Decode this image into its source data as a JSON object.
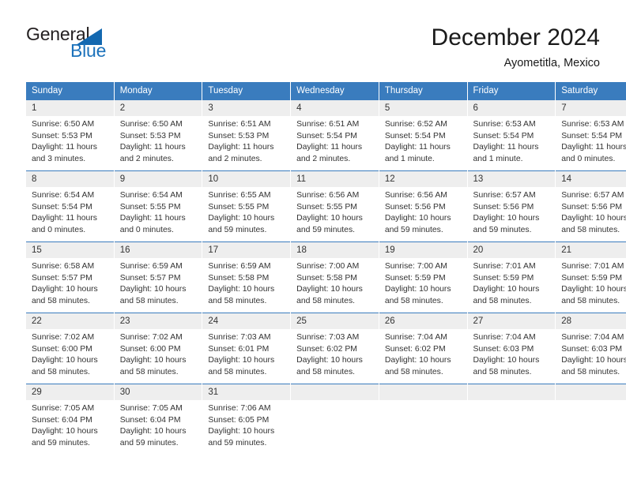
{
  "logo": {
    "word_top": "General",
    "word_bottom": "Blue",
    "accent_color": "#1368b0"
  },
  "header": {
    "title": "December 2024",
    "subtitle": "Ayometitla, Mexico"
  },
  "calendar": {
    "header_bg": "#3a7cbe",
    "daynum_bg": "#eeeeee",
    "weekdays": [
      "Sunday",
      "Monday",
      "Tuesday",
      "Wednesday",
      "Thursday",
      "Friday",
      "Saturday"
    ],
    "weeks": [
      [
        {
          "day": "1",
          "sunrise": "Sunrise: 6:50 AM",
          "sunset": "Sunset: 5:53 PM",
          "daylight": "Daylight: 11 hours and 3 minutes."
        },
        {
          "day": "2",
          "sunrise": "Sunrise: 6:50 AM",
          "sunset": "Sunset: 5:53 PM",
          "daylight": "Daylight: 11 hours and 2 minutes."
        },
        {
          "day": "3",
          "sunrise": "Sunrise: 6:51 AM",
          "sunset": "Sunset: 5:53 PM",
          "daylight": "Daylight: 11 hours and 2 minutes."
        },
        {
          "day": "4",
          "sunrise": "Sunrise: 6:51 AM",
          "sunset": "Sunset: 5:54 PM",
          "daylight": "Daylight: 11 hours and 2 minutes."
        },
        {
          "day": "5",
          "sunrise": "Sunrise: 6:52 AM",
          "sunset": "Sunset: 5:54 PM",
          "daylight": "Daylight: 11 hours and 1 minute."
        },
        {
          "day": "6",
          "sunrise": "Sunrise: 6:53 AM",
          "sunset": "Sunset: 5:54 PM",
          "daylight": "Daylight: 11 hours and 1 minute."
        },
        {
          "day": "7",
          "sunrise": "Sunrise: 6:53 AM",
          "sunset": "Sunset: 5:54 PM",
          "daylight": "Daylight: 11 hours and 0 minutes."
        }
      ],
      [
        {
          "day": "8",
          "sunrise": "Sunrise: 6:54 AM",
          "sunset": "Sunset: 5:54 PM",
          "daylight": "Daylight: 11 hours and 0 minutes."
        },
        {
          "day": "9",
          "sunrise": "Sunrise: 6:54 AM",
          "sunset": "Sunset: 5:55 PM",
          "daylight": "Daylight: 11 hours and 0 minutes."
        },
        {
          "day": "10",
          "sunrise": "Sunrise: 6:55 AM",
          "sunset": "Sunset: 5:55 PM",
          "daylight": "Daylight: 10 hours and 59 minutes."
        },
        {
          "day": "11",
          "sunrise": "Sunrise: 6:56 AM",
          "sunset": "Sunset: 5:55 PM",
          "daylight": "Daylight: 10 hours and 59 minutes."
        },
        {
          "day": "12",
          "sunrise": "Sunrise: 6:56 AM",
          "sunset": "Sunset: 5:56 PM",
          "daylight": "Daylight: 10 hours and 59 minutes."
        },
        {
          "day": "13",
          "sunrise": "Sunrise: 6:57 AM",
          "sunset": "Sunset: 5:56 PM",
          "daylight": "Daylight: 10 hours and 59 minutes."
        },
        {
          "day": "14",
          "sunrise": "Sunrise: 6:57 AM",
          "sunset": "Sunset: 5:56 PM",
          "daylight": "Daylight: 10 hours and 58 minutes."
        }
      ],
      [
        {
          "day": "15",
          "sunrise": "Sunrise: 6:58 AM",
          "sunset": "Sunset: 5:57 PM",
          "daylight": "Daylight: 10 hours and 58 minutes."
        },
        {
          "day": "16",
          "sunrise": "Sunrise: 6:59 AM",
          "sunset": "Sunset: 5:57 PM",
          "daylight": "Daylight: 10 hours and 58 minutes."
        },
        {
          "day": "17",
          "sunrise": "Sunrise: 6:59 AM",
          "sunset": "Sunset: 5:58 PM",
          "daylight": "Daylight: 10 hours and 58 minutes."
        },
        {
          "day": "18",
          "sunrise": "Sunrise: 7:00 AM",
          "sunset": "Sunset: 5:58 PM",
          "daylight": "Daylight: 10 hours and 58 minutes."
        },
        {
          "day": "19",
          "sunrise": "Sunrise: 7:00 AM",
          "sunset": "Sunset: 5:59 PM",
          "daylight": "Daylight: 10 hours and 58 minutes."
        },
        {
          "day": "20",
          "sunrise": "Sunrise: 7:01 AM",
          "sunset": "Sunset: 5:59 PM",
          "daylight": "Daylight: 10 hours and 58 minutes."
        },
        {
          "day": "21",
          "sunrise": "Sunrise: 7:01 AM",
          "sunset": "Sunset: 5:59 PM",
          "daylight": "Daylight: 10 hours and 58 minutes."
        }
      ],
      [
        {
          "day": "22",
          "sunrise": "Sunrise: 7:02 AM",
          "sunset": "Sunset: 6:00 PM",
          "daylight": "Daylight: 10 hours and 58 minutes."
        },
        {
          "day": "23",
          "sunrise": "Sunrise: 7:02 AM",
          "sunset": "Sunset: 6:00 PM",
          "daylight": "Daylight: 10 hours and 58 minutes."
        },
        {
          "day": "24",
          "sunrise": "Sunrise: 7:03 AM",
          "sunset": "Sunset: 6:01 PM",
          "daylight": "Daylight: 10 hours and 58 minutes."
        },
        {
          "day": "25",
          "sunrise": "Sunrise: 7:03 AM",
          "sunset": "Sunset: 6:02 PM",
          "daylight": "Daylight: 10 hours and 58 minutes."
        },
        {
          "day": "26",
          "sunrise": "Sunrise: 7:04 AM",
          "sunset": "Sunset: 6:02 PM",
          "daylight": "Daylight: 10 hours and 58 minutes."
        },
        {
          "day": "27",
          "sunrise": "Sunrise: 7:04 AM",
          "sunset": "Sunset: 6:03 PM",
          "daylight": "Daylight: 10 hours and 58 minutes."
        },
        {
          "day": "28",
          "sunrise": "Sunrise: 7:04 AM",
          "sunset": "Sunset: 6:03 PM",
          "daylight": "Daylight: 10 hours and 58 minutes."
        }
      ],
      [
        {
          "day": "29",
          "sunrise": "Sunrise: 7:05 AM",
          "sunset": "Sunset: 6:04 PM",
          "daylight": "Daylight: 10 hours and 59 minutes."
        },
        {
          "day": "30",
          "sunrise": "Sunrise: 7:05 AM",
          "sunset": "Sunset: 6:04 PM",
          "daylight": "Daylight: 10 hours and 59 minutes."
        },
        {
          "day": "31",
          "sunrise": "Sunrise: 7:06 AM",
          "sunset": "Sunset: 6:05 PM",
          "daylight": "Daylight: 10 hours and 59 minutes."
        },
        {
          "day": "",
          "sunrise": "",
          "sunset": "",
          "daylight": ""
        },
        {
          "day": "",
          "sunrise": "",
          "sunset": "",
          "daylight": ""
        },
        {
          "day": "",
          "sunrise": "",
          "sunset": "",
          "daylight": ""
        },
        {
          "day": "",
          "sunrise": "",
          "sunset": "",
          "daylight": ""
        }
      ]
    ]
  }
}
